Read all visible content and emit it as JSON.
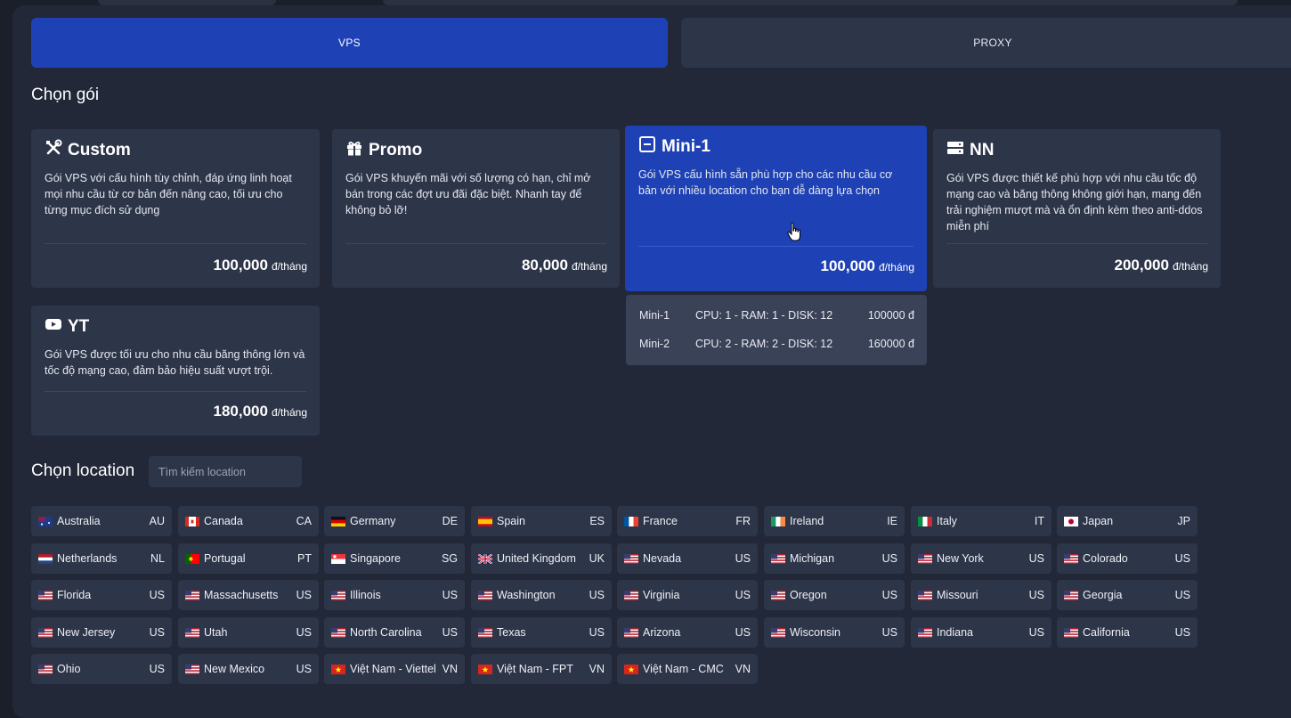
{
  "tabs": {
    "vps": "VPS",
    "proxy": "PROXY"
  },
  "package_section_title": "Chọn gói",
  "packages": [
    {
      "icon": "tools-icon",
      "name": "Custom",
      "desc": "Gói VPS với cấu hình tùy chỉnh, đáp ứng linh hoạt mọi nhu cầu từ cơ bản đến nâng cao, tối ưu cho từng mục đích sử dụng",
      "price": "100,000",
      "unit": "đ/tháng",
      "active": false
    },
    {
      "icon": "gift-icon",
      "name": "Promo",
      "desc": "Gói VPS khuyến mãi với số lượng có hạn, chỉ mở bán trong các đợt ưu đãi đặc biệt. Nhanh tay để không bỏ lỡ!",
      "price": "80,000",
      "unit": "đ/tháng",
      "active": false
    },
    {
      "icon": "minus-square-icon",
      "name": "Mini-1",
      "desc": "Gói VPS cấu hình sẵn phù hợp cho các nhu cầu cơ bản với nhiều location cho bạn dễ dàng lựa chọn",
      "price": "100,000",
      "unit": "đ/tháng",
      "active": true
    },
    {
      "icon": "server-icon",
      "name": "NN",
      "desc": "Gói VPS được thiết kế phù hợp với nhu cầu tốc độ mạng cao và băng thông không giới hạn, mang đến trải nghiệm mượt mà và ổn định kèm theo anti-ddos miễn phí",
      "price": "200,000",
      "unit": "đ/tháng",
      "active": false
    },
    {
      "icon": "youtube-icon",
      "name": "YT",
      "desc": "Gói VPS được tối ưu cho nhu cầu băng thông lớn và tốc độ mạng cao, đảm bảo hiệu suất vượt trội.",
      "price": "180,000",
      "unit": "đ/tháng",
      "active": false
    }
  ],
  "plan_options": [
    {
      "name": "Mini-1",
      "spec": "CPU: 1 - RAM: 1 - DISK: 12",
      "price": "100000 đ"
    },
    {
      "name": "Mini-2",
      "spec": "CPU: 2 - RAM: 2 - DISK: 12",
      "price": "160000 đ"
    }
  ],
  "location_section_title": "Chọn location",
  "location_search_placeholder": "Tìm kiếm location",
  "locations": [
    {
      "name": "Australia",
      "code": "AU",
      "flag": "au"
    },
    {
      "name": "Canada",
      "code": "CA",
      "flag": "ca"
    },
    {
      "name": "Germany",
      "code": "DE",
      "flag": "de"
    },
    {
      "name": "Spain",
      "code": "ES",
      "flag": "es"
    },
    {
      "name": "France",
      "code": "FR",
      "flag": "fr"
    },
    {
      "name": "Ireland",
      "code": "IE",
      "flag": "ie"
    },
    {
      "name": "Italy",
      "code": "IT",
      "flag": "it"
    },
    {
      "name": "Japan",
      "code": "JP",
      "flag": "jp"
    },
    {
      "name": "Netherlands",
      "code": "NL",
      "flag": "nl"
    },
    {
      "name": "Portugal",
      "code": "PT",
      "flag": "pt"
    },
    {
      "name": "Singapore",
      "code": "SG",
      "flag": "sg"
    },
    {
      "name": "United Kingdom",
      "code": "UK",
      "flag": "uk"
    },
    {
      "name": "Nevada",
      "code": "US",
      "flag": "us"
    },
    {
      "name": "Michigan",
      "code": "US",
      "flag": "us"
    },
    {
      "name": "New York",
      "code": "US",
      "flag": "us"
    },
    {
      "name": "Colorado",
      "code": "US",
      "flag": "us"
    },
    {
      "name": "Florida",
      "code": "US",
      "flag": "us"
    },
    {
      "name": "Massachusetts",
      "code": "US",
      "flag": "us"
    },
    {
      "name": "Illinois",
      "code": "US",
      "flag": "us"
    },
    {
      "name": "Washington",
      "code": "US",
      "flag": "us"
    },
    {
      "name": "Virginia",
      "code": "US",
      "flag": "us"
    },
    {
      "name": "Oregon",
      "code": "US",
      "flag": "us"
    },
    {
      "name": "Missouri",
      "code": "US",
      "flag": "us"
    },
    {
      "name": "Georgia",
      "code": "US",
      "flag": "us"
    },
    {
      "name": "New Jersey",
      "code": "US",
      "flag": "us"
    },
    {
      "name": "Utah",
      "code": "US",
      "flag": "us"
    },
    {
      "name": "North Carolina",
      "code": "US",
      "flag": "us"
    },
    {
      "name": "Texas",
      "code": "US",
      "flag": "us"
    },
    {
      "name": "Arizona",
      "code": "US",
      "flag": "us"
    },
    {
      "name": "Wisconsin",
      "code": "US",
      "flag": "us"
    },
    {
      "name": "Indiana",
      "code": "US",
      "flag": "us"
    },
    {
      "name": "California",
      "code": "US",
      "flag": "us"
    },
    {
      "name": "Ohio",
      "code": "US",
      "flag": "us"
    },
    {
      "name": "New Mexico",
      "code": "US",
      "flag": "us"
    },
    {
      "name": "Việt Nam - Viettel",
      "code": "VN",
      "flag": "vn"
    },
    {
      "name": "Việt Nam - FPT",
      "code": "VN",
      "flag": "vn"
    },
    {
      "name": "Việt Nam - CMC",
      "code": "VN",
      "flag": "vn"
    }
  ],
  "colors": {
    "background": "#1b1f29",
    "panel": "#222838",
    "card": "#2d3549",
    "accent": "#1e42b5",
    "dropdown": "#3a4258"
  }
}
